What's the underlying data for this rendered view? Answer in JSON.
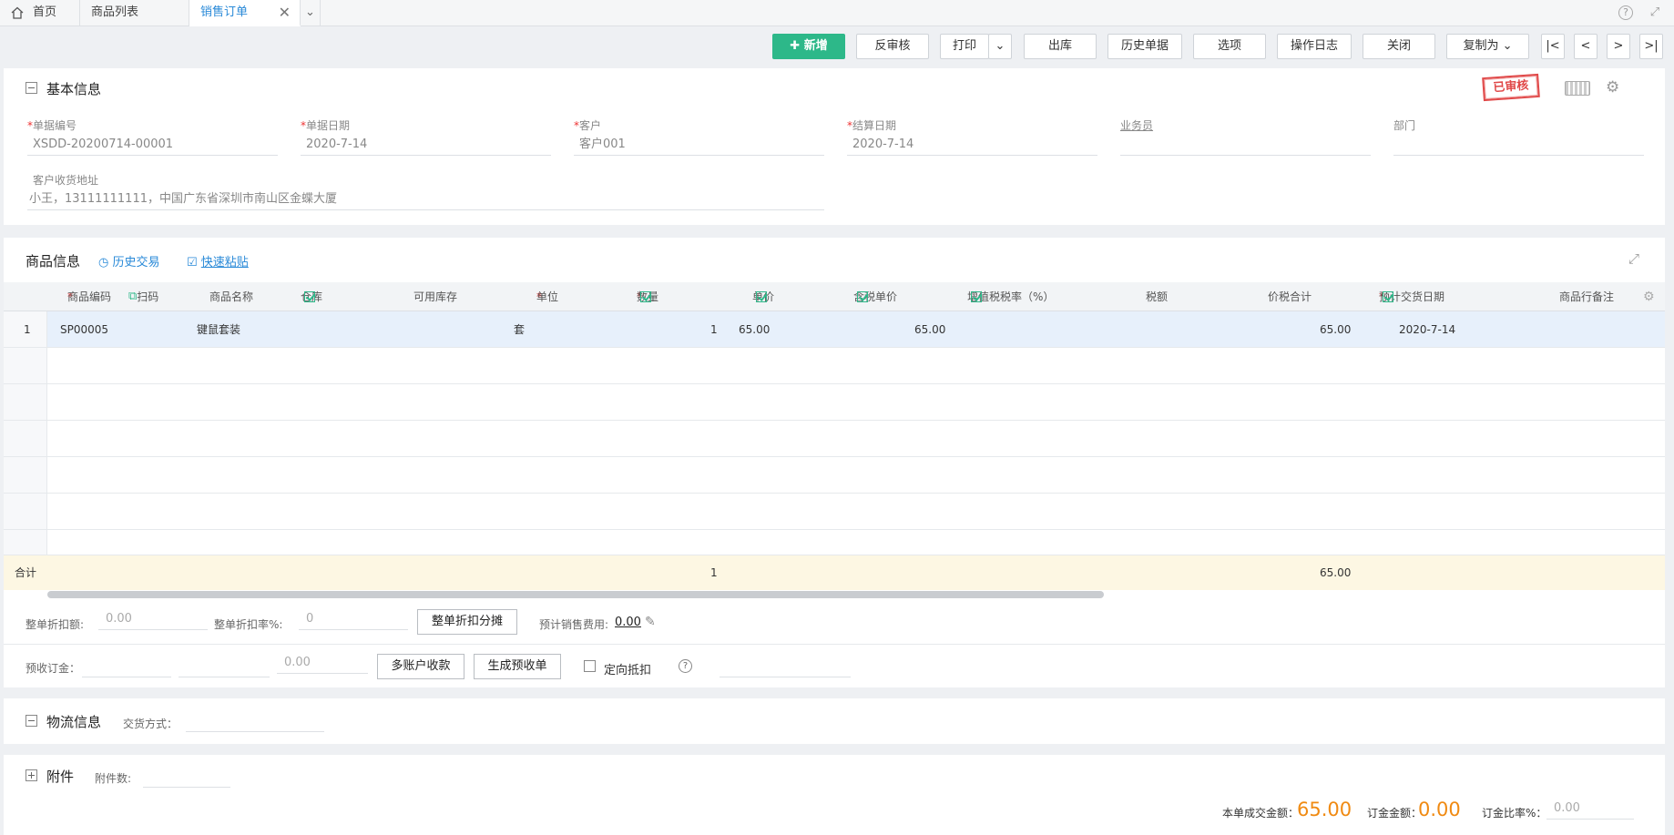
{
  "tabs": {
    "home": "首页",
    "products": "商品列表",
    "sales_order": "销售订单"
  },
  "toolbar": {
    "new": "新增",
    "unaudit": "反审核",
    "print": "打印",
    "outbound": "出库",
    "history": "历史单据",
    "options": "选项",
    "oplog": "操作日志",
    "close": "关闭",
    "copy_as": "复制为"
  },
  "basic": {
    "title": "基本信息",
    "stamp": "已审核",
    "fields": [
      {
        "label": "单据编号",
        "required": true,
        "value": "XSDD-20200714-00001"
      },
      {
        "label": "单据日期",
        "required": true,
        "value": "2020-7-14"
      },
      {
        "label": "客户",
        "required": true,
        "value": "客户001"
      },
      {
        "label": "结算日期",
        "required": true,
        "value": "2020-7-14"
      },
      {
        "label": "业务员",
        "required": false,
        "value": ""
      },
      {
        "label": "部门",
        "required": false,
        "value": ""
      }
    ],
    "address_label": "客户收货地址",
    "address_value": "小王，13111111111，中国广东省深圳市南山区金蝶大厦"
  },
  "goods": {
    "title": "商品信息",
    "history_link": "历史交易",
    "paste_link": "快速粘贴",
    "scan": "扫码",
    "columns": [
      "商品编码",
      "商品名称",
      "仓库",
      "可用库存",
      "单位",
      "数量",
      "单价",
      "含税单价",
      "增值税税率（%）",
      "税额",
      "价税合计",
      "预计交货日期",
      "商品行备注"
    ],
    "rows": [
      {
        "no": "1",
        "code": "SP00005",
        "name": "键鼠套装",
        "unit": "套",
        "qty": "1",
        "price": "65.00",
        "tax_price": "65.00",
        "total": "65.00",
        "date": "2020-7-14"
      }
    ],
    "sum_label": "合计",
    "sum_qty": "1",
    "sum_total": "65.00"
  },
  "discount": {
    "amount_label": "整单折扣额:",
    "amount_value": "0.00",
    "rate_label": "整单折扣率%:",
    "rate_value": "0",
    "alloc_btn": "整单折扣分摊",
    "fee_label": "预计销售费用:",
    "fee_value": "0.00"
  },
  "prepay": {
    "label": "预收订金：",
    "value": "0.00",
    "multi_btn": "多账户收款",
    "gen_btn": "生成预收单",
    "directed": "定向抵扣"
  },
  "logistics": {
    "title": "物流信息",
    "mode_label": "交货方式："
  },
  "attach": {
    "title": "附件",
    "count_label": "附件数:"
  },
  "summary": {
    "cost_label": "本单成交金额：",
    "cost_value": "65.00",
    "deposit_label": "订金金额：",
    "deposit_value": "0.00",
    "ratio_label": "订金比率%：",
    "ratio_value": "0.00"
  }
}
